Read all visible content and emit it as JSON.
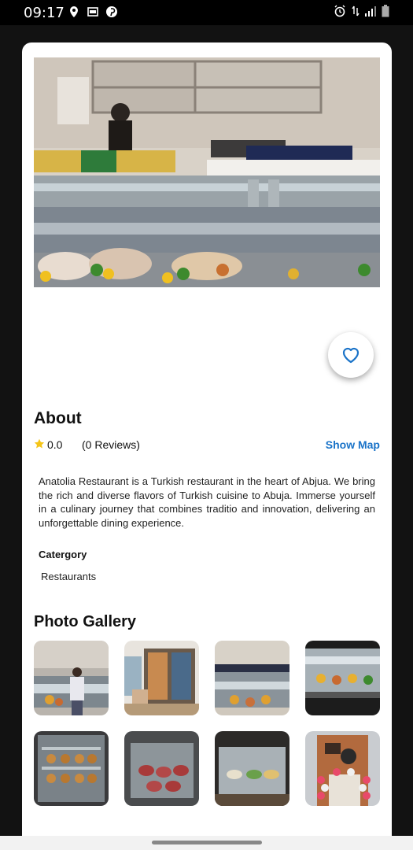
{
  "status_bar": {
    "time": "09:17",
    "left_icons": [
      "location-pin-icon",
      "sim-card-icon",
      "pinterest-icon"
    ],
    "right_icons": [
      "alarm-icon",
      "data-arrows-icon",
      "signal-icon",
      "battery-icon"
    ]
  },
  "restaurant": {
    "hero_image": "restaurant-display-counter-photo",
    "favorite_icon": "heart-outline-icon",
    "accent_color": "#1a73c8"
  },
  "about": {
    "title": "About",
    "rating": "0.0",
    "reviews": "(0 Reviews)",
    "show_map": "Show Map",
    "description": "Anatolia Restaurant is a Turkish restaurant in the heart of Abjua. We bring the rich and diverse flavors of Turkish cuisine to Abuja. Immerse yourself in a culinary journey that combines traditio and innovation, delivering an unforgettable dining experience.",
    "category_label": "Catergory",
    "category_value": "Restaurants"
  },
  "gallery": {
    "title": "Photo Gallery",
    "photos": [
      "staff-at-counter-photo",
      "mural-dining-area-photo",
      "display-counter-photo",
      "food-display-case-photo",
      "baked-goods-case-photo",
      "meat-display-photo",
      "salad-bar-photo",
      "storefront-balloons-photo"
    ]
  }
}
